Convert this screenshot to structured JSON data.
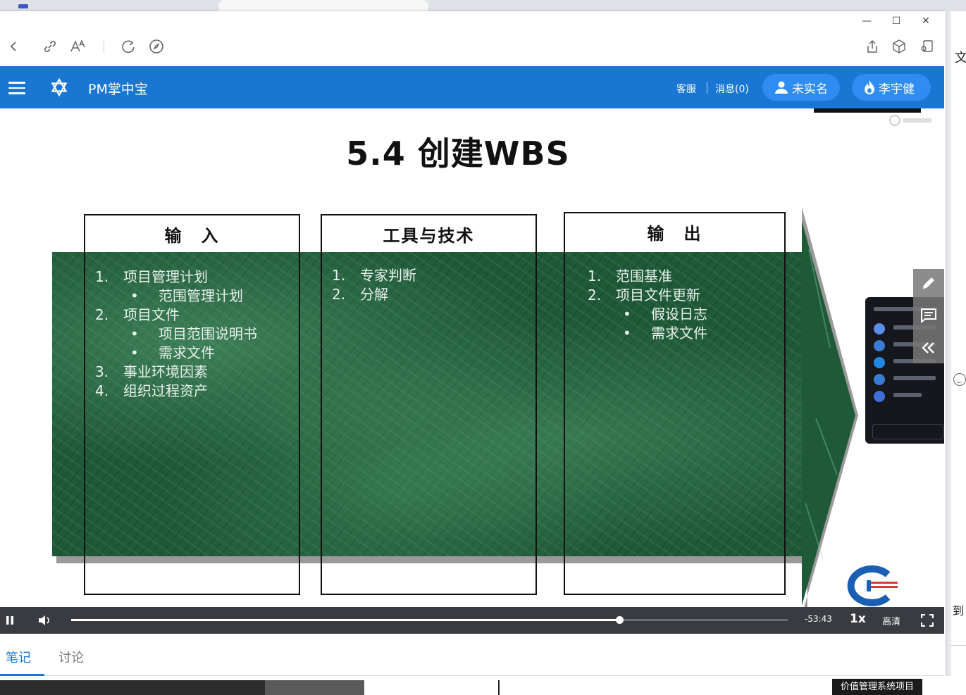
{
  "window": {
    "controls": {
      "minimize": "—",
      "maximize": "☐",
      "close": "✕"
    }
  },
  "toolbar": {
    "icons": [
      "back-icon",
      "link-icon",
      "font-size-icon",
      "refresh-icon",
      "compass-icon",
      "share-icon",
      "cube-icon",
      "user-screen-icon"
    ]
  },
  "header": {
    "app_title": "PM掌中宝",
    "customer_service": "客服",
    "messages": "消息(0)",
    "verify_button": "未实名",
    "user_button": "李宇健",
    "bg_color": "#1976d2",
    "pill_color": "#2f8cf0"
  },
  "slide": {
    "title": "5.4 创建WBS",
    "columns": [
      {
        "heading": "输　入",
        "items": [
          {
            "type": "item",
            "num": "1.",
            "text": "项目管理计划"
          },
          {
            "type": "sub",
            "text": "范围管理计划"
          },
          {
            "type": "item",
            "num": "2.",
            "text": "项目文件"
          },
          {
            "type": "sub",
            "text": "项目范围说明书"
          },
          {
            "type": "sub",
            "text": "需求文件"
          },
          {
            "type": "item",
            "num": "3.",
            "text": "事业环境因素"
          },
          {
            "type": "item",
            "num": "4.",
            "text": "组织过程资产"
          }
        ]
      },
      {
        "heading": "工具与技术",
        "items": [
          {
            "type": "item",
            "num": "1.",
            "text": "专家判断"
          },
          {
            "type": "item",
            "num": "2.",
            "text": "分解"
          }
        ]
      },
      {
        "heading": "输　出",
        "items": [
          {
            "type": "item",
            "num": "1.",
            "text": "范围基准"
          },
          {
            "type": "item",
            "num": "2.",
            "text": "项目文件更新"
          },
          {
            "type": "sub",
            "text": "假设日志"
          },
          {
            "type": "sub",
            "text": "需求文件"
          }
        ]
      }
    ]
  },
  "side_tools": {
    "icons": [
      "pencil-icon",
      "comment-icon",
      "collapse-left-icon"
    ]
  },
  "player": {
    "time_remaining": "-53:43",
    "speed": "1x",
    "quality": "高清",
    "progress": 0.765
  },
  "tabs": [
    {
      "label": "笔记",
      "active": true
    },
    {
      "label": "讨论",
      "active": false
    }
  ],
  "bottom": {
    "label": "价值管理系统项目"
  },
  "desktop_fragments": {
    "top_glyph": "文",
    "bottom_glyph": "到"
  }
}
